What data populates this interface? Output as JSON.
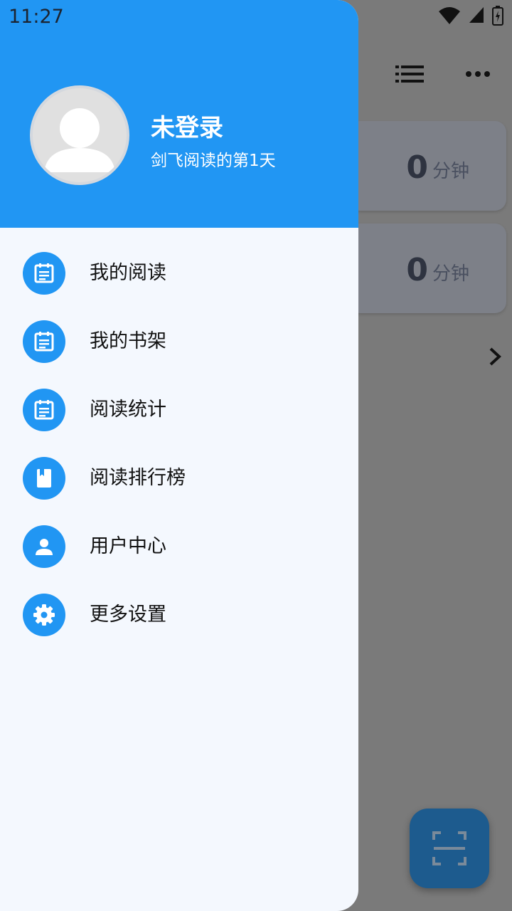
{
  "status_bar": {
    "time": "11:27"
  },
  "user": {
    "name": "未登录",
    "subtitle": "剑飞阅读的第1天"
  },
  "menu": [
    {
      "label": "我的阅读",
      "icon": "note-icon"
    },
    {
      "label": "我的书架",
      "icon": "note-icon"
    },
    {
      "label": "阅读统计",
      "icon": "note-icon"
    },
    {
      "label": "阅读排行榜",
      "icon": "book-icon"
    },
    {
      "label": "用户中心",
      "icon": "person-icon"
    },
    {
      "label": "更多设置",
      "icon": "gear-icon"
    }
  ],
  "background": {
    "cards": [
      {
        "value": "0",
        "unit": "分钟"
      },
      {
        "value": "0",
        "unit": "分钟"
      }
    ]
  },
  "colors": {
    "accent": "#2196f3",
    "drawer_bg": "#f4f8fe",
    "scrim": "#777777"
  }
}
